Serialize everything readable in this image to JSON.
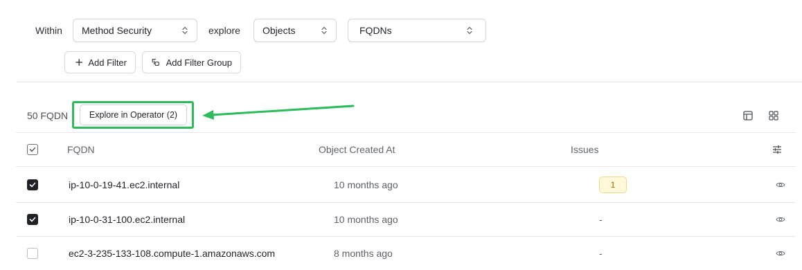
{
  "filters": {
    "within_label": "Within",
    "within_value": "Method Security",
    "explore_label": "explore",
    "explore_value": "Objects",
    "type_value": "FQDNs",
    "add_filter_label": "Add Filter",
    "add_filter_group_label": "Add Filter Group"
  },
  "results": {
    "count_label": "50 FQDN",
    "explore_operator_label": "Explore in Operator (2)"
  },
  "table": {
    "columns": [
      "FQDN",
      "Object Created At",
      "Issues"
    ],
    "rows": [
      {
        "fqdn": "ip-10-0-19-41.ec2.internal",
        "created": "10 months ago",
        "issues": "1",
        "checked": true
      },
      {
        "fqdn": "ip-10-0-31-100.ec2.internal",
        "created": "10 months ago",
        "issues": "-",
        "checked": true
      },
      {
        "fqdn": "ec2-3-235-133-108.compute-1.amazonaws.com",
        "created": "8 months ago",
        "issues": "-",
        "checked": false
      }
    ]
  },
  "colors": {
    "highlight": "#2dbb5b",
    "arrow": "#2dbb5b",
    "badge_bg": "#fff8d9",
    "badge_text": "#9a6a00"
  },
  "icons": {
    "select_chevrons": "chevron-up-down-icon",
    "add_filter": "plus-icon",
    "add_filter_group": "filter-group-icon",
    "table_view": "table-view-icon",
    "grid_view": "grid-view-icon",
    "column_settings": "sliders-icon",
    "row_action": "eye-icon"
  }
}
